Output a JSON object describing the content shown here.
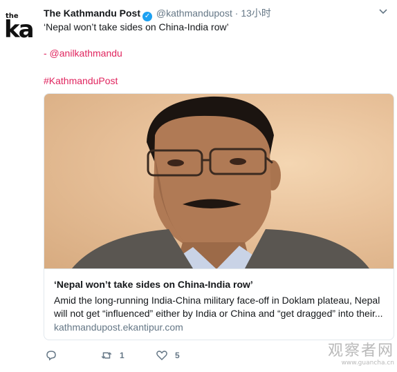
{
  "account": {
    "name": "The Kathmandu Post",
    "handle": "@kathmandupost",
    "separator": "·",
    "time": "13小时",
    "avatar_top": "the",
    "avatar_main": "ka"
  },
  "tweet": {
    "text_line1": "‘Nepal won’t take sides on China-India row’",
    "mention": "- @anilkathmandu",
    "hashtag": "#KathmanduPost"
  },
  "card": {
    "title": "‘Nepal won’t take sides on China-India row’",
    "description_line1": "Amid the long-running India-China military face-off in Doklam plateau, Nepal",
    "description_line2": "will not get “influenced” either by India or China and “get dragged” into their...",
    "domain": "kathmandupost.ekantipur.com"
  },
  "actions": {
    "reply_count": "",
    "retweet_count": "1",
    "like_count": "5"
  },
  "watermark": {
    "main": "观察者网",
    "sub": "www.guancha.cn"
  },
  "icons": {
    "verified": "verified-badge-icon",
    "caret": "chevron-down-icon",
    "reply": "reply-icon",
    "retweet": "retweet-icon",
    "like": "heart-icon"
  },
  "colors": {
    "link": "#e0245e",
    "verified": "#1da1f2",
    "muted": "#657786"
  }
}
